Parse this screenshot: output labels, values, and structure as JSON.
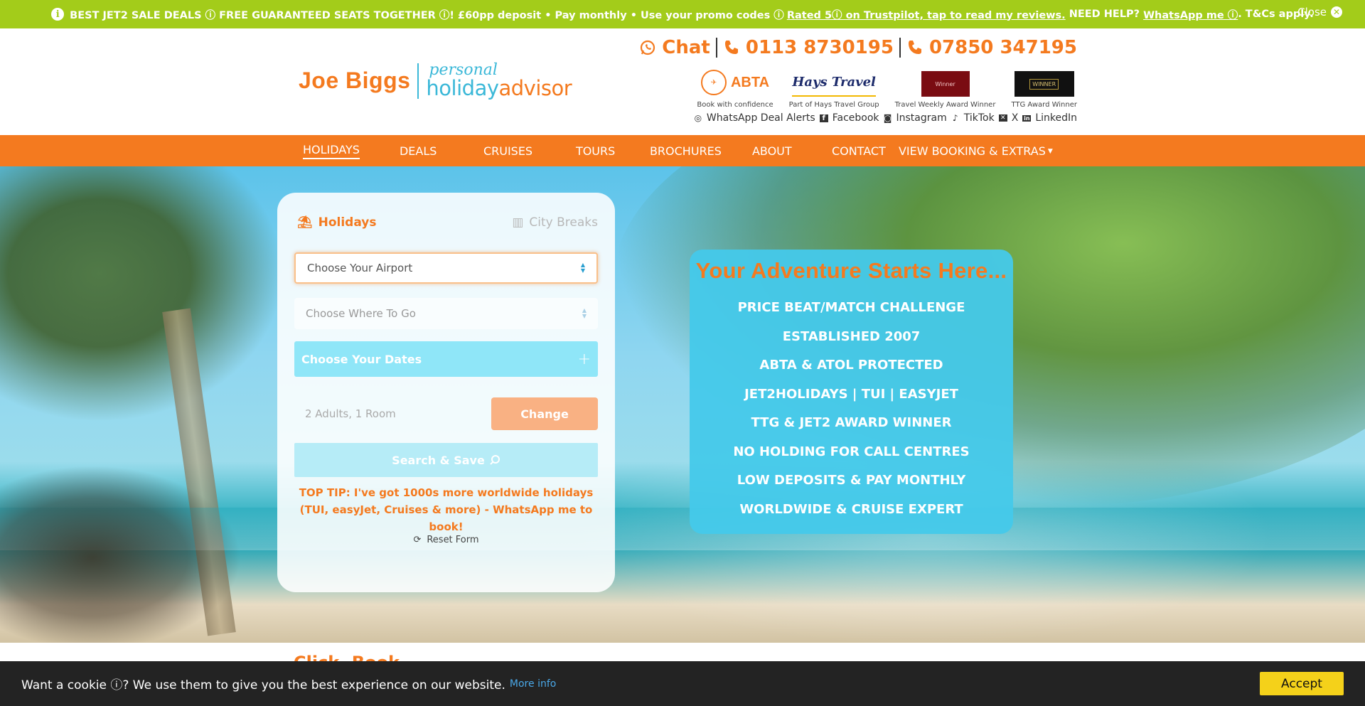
{
  "banner": {
    "text_main": "BEST JET2 SALE DEALS ⓘ FREE GUARANTEED SEATS TOGETHER ⓘ! £60pp deposit • Pay monthly • Use your promo codes ⓘ",
    "trustpilot_link": "Rated 5ⓘ on Trustpilot, tap to read my reviews.",
    "help_text": "NEED HELP?",
    "whatsapp_link": "WhatsApp me ⓘ",
    "terms": ". T&Cs apply.",
    "close_label": "Close",
    "bg_color": "#a3cc1a"
  },
  "logo": {
    "name": "Joe Biggs",
    "personal": "personal",
    "holiday": "holiday",
    "advisor": "advisor"
  },
  "contacts": {
    "chat": "Chat",
    "phone1": "0113 8730195",
    "phone2": "07850 347195"
  },
  "awards": [
    {
      "caption": "Book with confidence",
      "badge": "ABTA"
    },
    {
      "caption": "Part of Hays Travel Group",
      "badge": "Hays Travel"
    },
    {
      "caption": "Travel Weekly Award Winner",
      "badge": "Winner"
    },
    {
      "caption": "TTG Award Winner",
      "badge": "WINNER"
    }
  ],
  "social": [
    {
      "label": "WhatsApp Deal Alerts",
      "icon": "whatsapp-icon"
    },
    {
      "label": "Facebook",
      "icon": "facebook-icon"
    },
    {
      "label": "Instagram",
      "icon": "instagram-icon"
    },
    {
      "label": "TikTok",
      "icon": "tiktok-icon"
    },
    {
      "label": "X",
      "icon": "x-icon"
    },
    {
      "label": "LinkedIn",
      "icon": "linkedin-icon"
    }
  ],
  "nav": [
    "HOLIDAYS",
    "DEALS",
    "CRUISES",
    "TOURS",
    "BROCHURES",
    "ABOUT",
    "CONTACT",
    "VIEW BOOKING & EXTRAS"
  ],
  "search": {
    "tab_holidays": "Holidays",
    "tab_city": "City Breaks",
    "airport_placeholder": "Choose Your Airport",
    "destination_placeholder": "Choose Where To Go",
    "dates_label": "Choose Your Dates",
    "guests_value": "2 Adults, 1 Room",
    "change_label": "Change",
    "search_label": "Search & Save",
    "tip": "TOP TIP: I've got 1000s more worldwide holidays (TUI, easyJet, Cruises & more) - WhatsApp me to book!",
    "reset_label": "Reset Form"
  },
  "adventure": {
    "title": "Your Adventure Starts Here...",
    "items": [
      "PRICE BEAT/MATCH CHALLENGE",
      "ESTABLISHED 2007",
      "ABTA & ATOL PROTECTED",
      "JET2HOLIDAYS | TUI | EASYJET",
      "TTG & JET2 AWARD WINNER",
      "NO HOLDING FOR CALL CENTRES",
      "LOW DEPOSITS & PAY MONTHLY",
      "WORLDWIDE & CRUISE EXPERT"
    ]
  },
  "below": {
    "heading": "Click. Book."
  },
  "cookie": {
    "text": "Want a cookie ⓘ? We use them to give you the best experience on our website.",
    "more_info": "More info",
    "accept": "Accept"
  },
  "colors": {
    "orange": "#f47a1f",
    "cyan": "#44c9ea",
    "green": "#a3cc1a"
  }
}
